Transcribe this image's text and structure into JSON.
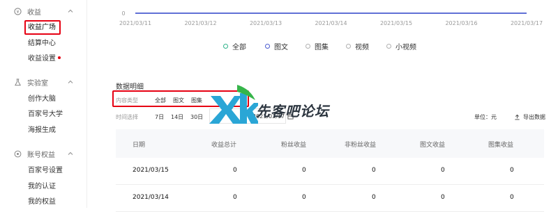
{
  "sidebar": {
    "sections": [
      {
        "title": "收益",
        "icon": "revenue-icon",
        "items": [
          {
            "label": "收益广场",
            "active": true
          },
          {
            "label": "结算中心"
          },
          {
            "label": "收益设置",
            "dot": true
          }
        ]
      },
      {
        "title": "实验室",
        "icon": "lab-icon",
        "items": [
          {
            "label": "创作大脑"
          },
          {
            "label": "百家号大学"
          },
          {
            "label": "海报生成"
          }
        ]
      },
      {
        "title": "账号权益",
        "icon": "account-icon",
        "items": [
          {
            "label": "百家号设置"
          },
          {
            "label": "我的认证"
          },
          {
            "label": "我的权益"
          }
        ]
      }
    ]
  },
  "chart_data": {
    "type": "line",
    "x": [
      "2021/03/11",
      "2021/03/12",
      "2021/03/13",
      "2021/03/14",
      "2021/03/15",
      "2021/03/16",
      "2021/03/17"
    ],
    "series": [
      {
        "name": "全部",
        "values": [
          0,
          0,
          0,
          0,
          0,
          0,
          0
        ],
        "color": "#4a5bd0"
      }
    ],
    "ytick": "0"
  },
  "legend": [
    {
      "label": "全部",
      "color": "#2fb38a"
    },
    {
      "label": "图文",
      "color": "#4a5bd0"
    },
    {
      "label": "图集",
      "color": "#b0b0b0"
    },
    {
      "label": "视频",
      "color": "#b0b0b0"
    },
    {
      "label": "小视频",
      "color": "#b0b0b0"
    }
  ],
  "details": {
    "title": "数据明细",
    "content_type_label": "内容类型",
    "content_types": [
      "全部",
      "图文",
      "图集"
    ],
    "time_label": "时间选择",
    "time_ranges": [
      "7日",
      "14日",
      "30日"
    ],
    "date_end": "2021/03/17",
    "unit": "单位：元",
    "export": "导出数据"
  },
  "table": {
    "columns": [
      "日期",
      "收益总计",
      "粉丝收益",
      "非粉丝收益",
      "图文收益",
      "图集收益"
    ],
    "rows": [
      [
        "2021/03/15",
        "0",
        "0",
        "0",
        "0",
        "0"
      ],
      [
        "2021/03/14",
        "0",
        "0",
        "0",
        "0",
        "0"
      ]
    ]
  },
  "watermark": {
    "text": "先客吧论坛"
  }
}
